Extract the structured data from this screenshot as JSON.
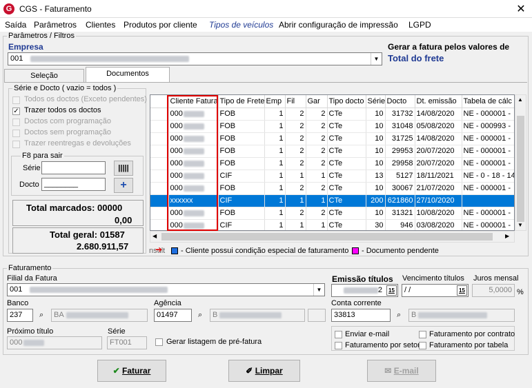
{
  "window": {
    "title": "CGS - Faturamento",
    "close_glyph": "✕",
    "icon_letter": "G"
  },
  "menu": [
    "Saída",
    "Parâmetros",
    "Clientes",
    "Produtos por cliente",
    "Tipos de veículos",
    "Abrir configuração de impressão",
    "LGPD"
  ],
  "params": {
    "group_label": "Parâmetros / Filtros",
    "empresa_label": "Empresa",
    "empresa_code": "001",
    "gerar_label": "Gerar a fatura pelos valores de",
    "gerar_value": "Total do frete"
  },
  "tabs": [
    "Seleção",
    "Documentos"
  ],
  "serie": {
    "group_label": "Série e Docto ( vazio = todos )",
    "options": [
      {
        "label": "Todos os doctos (Exceto pendentes)",
        "checked": false,
        "enabled": false
      },
      {
        "label": "Trazer todos os doctos",
        "checked": true,
        "enabled": true
      },
      {
        "label": "Doctos com programação",
        "checked": false,
        "enabled": false
      },
      {
        "label": "Doctos sem programação",
        "checked": false,
        "enabled": false
      },
      {
        "label": "Trazer reentregas e devoluções",
        "checked": false,
        "enabled": false
      }
    ],
    "f8_label": "F8 para sair",
    "serie_label": "Série",
    "docto_label": "Docto",
    "docto_value": "________"
  },
  "totals": {
    "marcados_label": "Total marcados: 00000",
    "marcados_value": "0,00",
    "geral_label": "Total geral: 01587",
    "geral_value": "2.680.911,57"
  },
  "grid": {
    "columns": [
      "",
      "Cliente Fatura",
      "Tipo de Frete",
      "Emp",
      "Fil",
      "Gar",
      "Tipo docto",
      "Série",
      "Docto",
      "Dt. emissão",
      "Tabela de cálc"
    ],
    "rows": [
      [
        "",
        "000",
        "FOB",
        "1",
        "2",
        "2",
        "CTe",
        "10",
        "31732",
        "14/08/2020",
        "NE - 000001 -"
      ],
      [
        "",
        "000",
        "FOB",
        "1",
        "2",
        "2",
        "CTe",
        "10",
        "31048",
        "05/08/2020",
        "NE - 000993 -"
      ],
      [
        "",
        "000",
        "FOB",
        "1",
        "2",
        "2",
        "CTe",
        "10",
        "31725",
        "14/08/2020",
        "NE - 000001 -"
      ],
      [
        "",
        "000",
        "FOB",
        "1",
        "2",
        "2",
        "CTe",
        "10",
        "29953",
        "20/07/2020",
        "NE - 000001 -"
      ],
      [
        "",
        "000",
        "FOB",
        "1",
        "2",
        "2",
        "CTe",
        "10",
        "29958",
        "20/07/2020",
        "NE - 000001 -"
      ],
      [
        "",
        "000",
        "CIF",
        "1",
        "1",
        "1",
        "CTe",
        "13",
        "5127",
        "18/11/2021",
        "NE - 0 - 18 - 14"
      ],
      [
        "",
        "000",
        "FOB",
        "1",
        "2",
        "2",
        "CTe",
        "10",
        "30067",
        "21/07/2020",
        "NE - 000001 -"
      ],
      [
        "",
        "xxxxxx",
        "CIF",
        "1",
        "1",
        "1",
        "CTe",
        "200",
        "621860",
        "27/10/2020",
        ""
      ],
      [
        "",
        "000",
        "FOB",
        "1",
        "2",
        "2",
        "CTe",
        "10",
        "31321",
        "10/08/2020",
        "NE - 000001 -"
      ],
      [
        "",
        "000",
        "CIF",
        "1",
        "1",
        "1",
        "CTe",
        "30",
        "946",
        "03/08/2020",
        "NE - 000001 -"
      ]
    ],
    "selected_row": 7
  },
  "legend": {
    "prefix": "nsult",
    "item1": "- Cliente possui condição especial de faturamento",
    "item2": "- Documento pendente",
    "color1": "#1f6fe0",
    "color2": "#ff00ff"
  },
  "faturamento": {
    "group_label": "Faturamento",
    "filial_label": "Filial da Fatura",
    "filial_code": "001",
    "emissao_label": "Emissão títulos",
    "emissao_value": "2",
    "vencimento_label": "Vencimento títulos",
    "vencimento_value": "/ /",
    "juros_label": "Juros mensal",
    "juros_value": "5,0000",
    "juros_unit": "%",
    "banco_label": "Banco",
    "banco_value": "237",
    "banco_name": "BA",
    "agencia_label": "Agência",
    "agencia_value": "01497",
    "agencia_name": "B",
    "conta_label": "Conta corrente",
    "conta_value": "33813",
    "conta_name": "B",
    "proximo_label": "Próximo título",
    "proximo_value": "000",
    "serie_label": "Série",
    "serie_value": "FT001",
    "gerar_listagem": "Gerar listagem de pré-fatura",
    "enviar_email": "Enviar e-mail",
    "fat_setor": "Faturamento por setor",
    "fat_contrato": "Faturamento por contrato",
    "fat_tabela": "Faturamento por tabela",
    "calendar_glyph": "15"
  },
  "buttons": {
    "faturar": "Faturar",
    "limpar": "Limpar",
    "email": "E-mail"
  }
}
